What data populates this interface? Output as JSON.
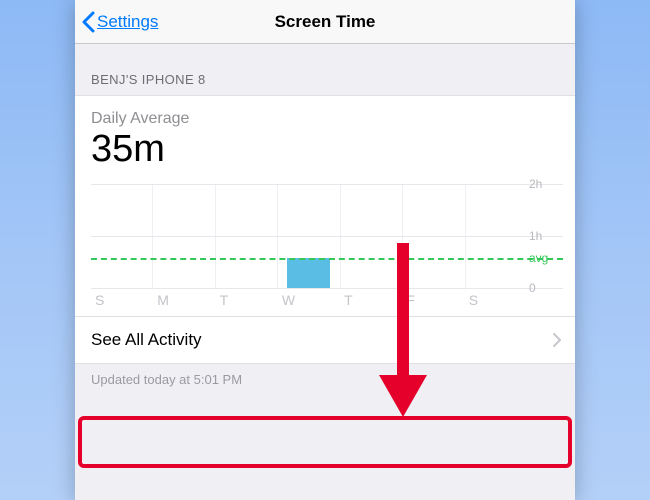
{
  "nav": {
    "back_label": "Settings",
    "title": "Screen Time"
  },
  "section": {
    "device_header": "BENJ'S IPHONE 8"
  },
  "summary": {
    "label": "Daily Average",
    "value": "35m"
  },
  "chart_data": {
    "type": "bar",
    "categories": [
      "S",
      "M",
      "T",
      "W",
      "T",
      "F",
      "S"
    ],
    "values": [
      0,
      0,
      0,
      35,
      0,
      0,
      0
    ],
    "unit": "minutes",
    "ylim": [
      0,
      120
    ],
    "ylabel": "",
    "xlabel": "",
    "gridlines_at": [
      0,
      60,
      120
    ],
    "y_tick_labels": {
      "0": "0",
      "60": "1h",
      "120": "2h"
    },
    "avg": 35,
    "avg_label": "avg",
    "bar_color": "#5abde3",
    "avg_color": "#34c759"
  },
  "row": {
    "see_all": "See All Activity"
  },
  "footer": {
    "updated": "Updated today at 5:01 PM"
  }
}
